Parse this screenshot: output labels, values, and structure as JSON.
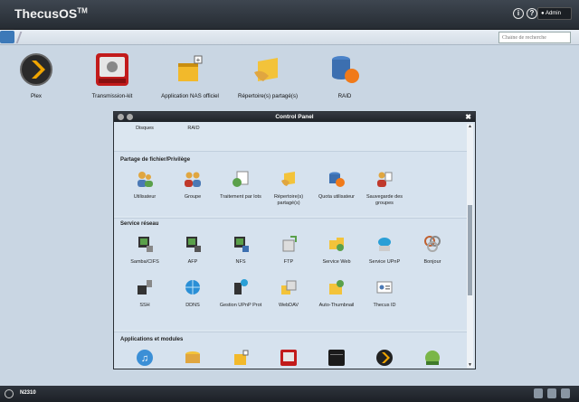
{
  "header": {
    "logo": "ThecusOS",
    "logo_tm": "TM",
    "info_icon": "i",
    "help_icon": "?",
    "user_label": "Admin"
  },
  "toolbar": {
    "search_placeholder": "Chaîne de recherche"
  },
  "desktop": {
    "items": [
      {
        "label": "Plex",
        "icon": "plex-icon"
      },
      {
        "label": "Transmission-kit",
        "icon": "transmission-icon"
      },
      {
        "label": "Application NAS officiel",
        "icon": "nas-app-icon"
      },
      {
        "label": "Répertoire(s) partagé(s)",
        "icon": "shared-folder-icon"
      },
      {
        "label": "RAID",
        "icon": "raid-icon"
      }
    ]
  },
  "control_panel": {
    "title": "Control Panel",
    "top_items": [
      "Disques",
      "RAID"
    ],
    "sections": [
      {
        "title": "Partage de fichier/Privilège",
        "items": [
          "Utilisateur",
          "Groupe",
          "Traitement par lots",
          "Répertoire(s) partagé(s)",
          "Quota utilisateur",
          "Sauvegarde des groupes"
        ]
      },
      {
        "title": "Service réseau",
        "items": [
          "Samba/CIFS",
          "AFP",
          "NFS",
          "FTP",
          "Service Web",
          "Service UPnP",
          "Bonjour",
          "SSH",
          "DDNS",
          "Gestion UPnP Prot",
          "WebDAV",
          "Auto-Thumbnail",
          "Thecus ID"
        ]
      },
      {
        "title": "Applications et modules",
        "items": [
          "",
          "",
          "",
          "",
          "",
          "",
          ""
        ]
      }
    ]
  },
  "taskbar": {
    "model": "N2310"
  },
  "colors": {
    "accent": "#3c79b8",
    "topbar": "#2b3139",
    "panel_bg": "#dbe6f0"
  }
}
